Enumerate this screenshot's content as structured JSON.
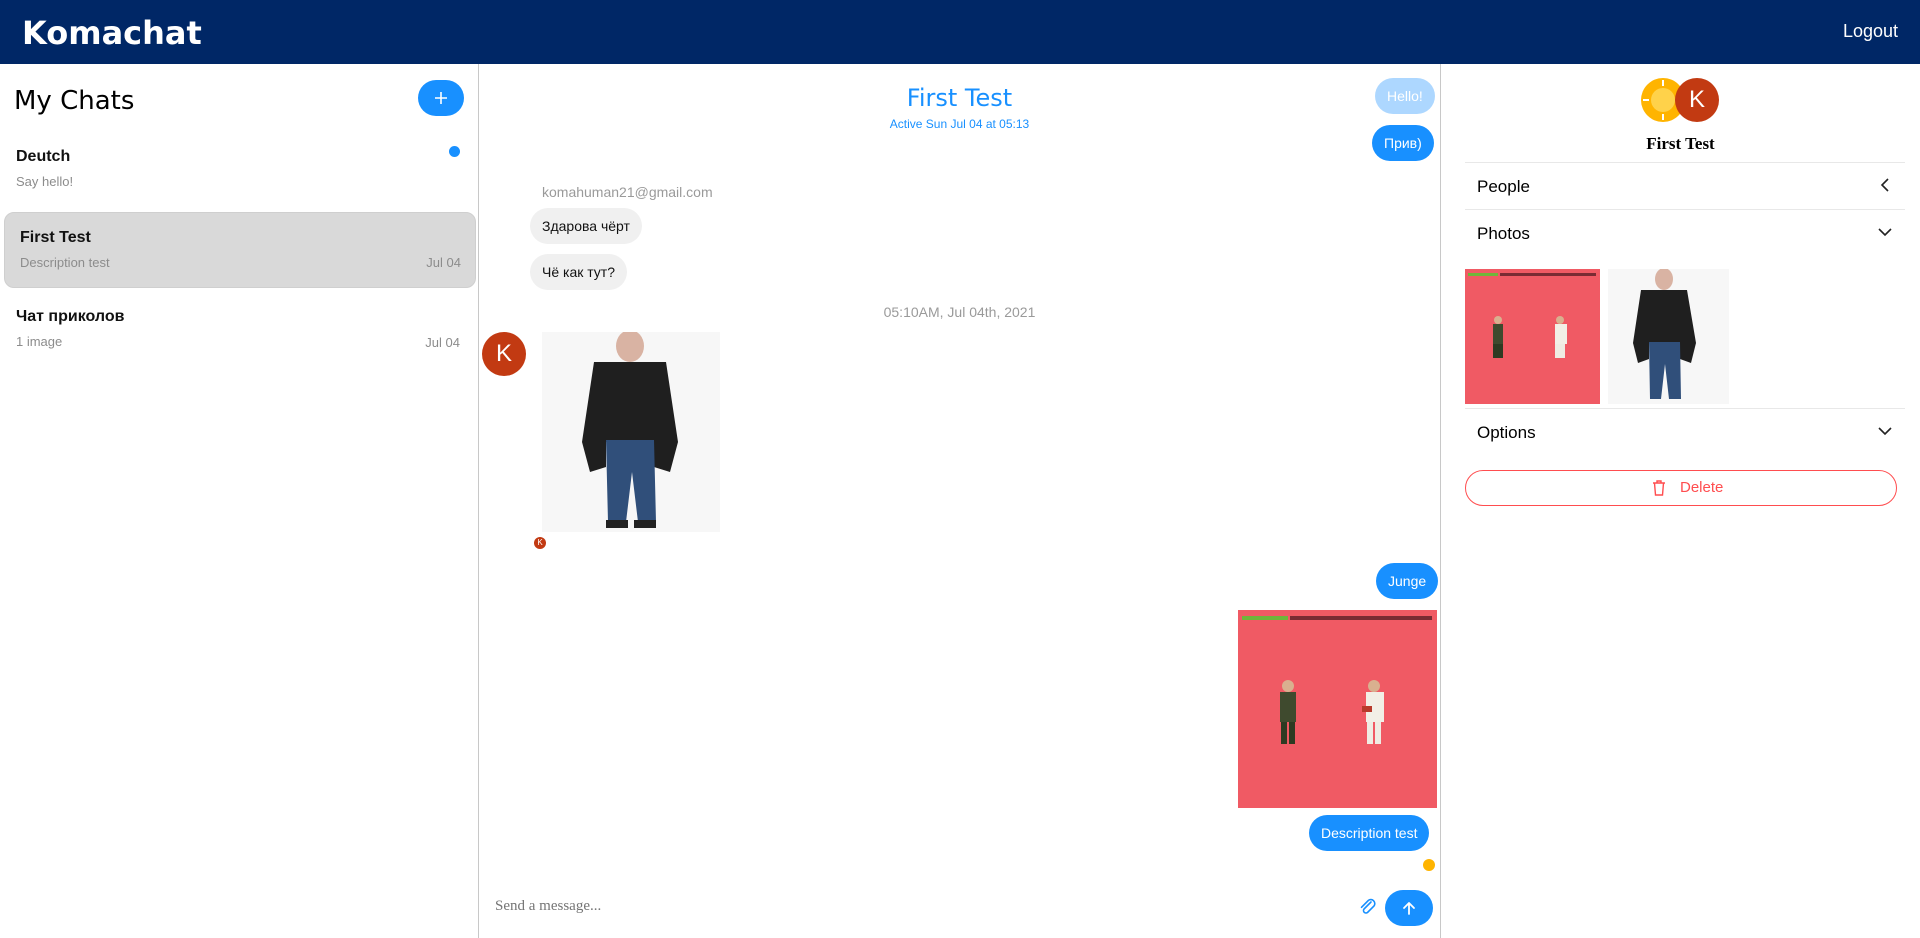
{
  "app": {
    "name": "Komachat",
    "logout_label": "Logout"
  },
  "sidebar": {
    "title": "My Chats",
    "new_chat_icon": "plus-icon",
    "chats": [
      {
        "title": "Deutch",
        "subtitle": "Say hello!",
        "date": "",
        "unread": true
      },
      {
        "title": "First Test",
        "subtitle": "Description test",
        "date": "Jul 04",
        "unread": false
      },
      {
        "title": "Чат приколов",
        "subtitle": "1 image",
        "date": "Jul 04",
        "unread": false
      }
    ]
  },
  "chat": {
    "title": "First Test",
    "subtitle": "Active Sun Jul 04 at 05:13",
    "messages": {
      "hello": "Hello!",
      "priv": "Прив)",
      "sender": "komahuman21@gmail.com",
      "m1": "Здарова чёрт",
      "m2": "Чё как тут?",
      "timestamp": "05:10AM, Jul 04th, 2021",
      "avatar_letter": "K",
      "junge": "Junge",
      "description": "Description test"
    },
    "composer": {
      "placeholder": "Send a message..."
    }
  },
  "settings": {
    "title": "First Test",
    "avatar_letter": "K",
    "sections": {
      "people": "People",
      "photos": "Photos",
      "options": "Options"
    },
    "delete_label": "Delete"
  },
  "colors": {
    "topbar": "#002766",
    "accent": "#1890ff",
    "danger": "#ff4d4f",
    "avatar": "#c23a12"
  }
}
